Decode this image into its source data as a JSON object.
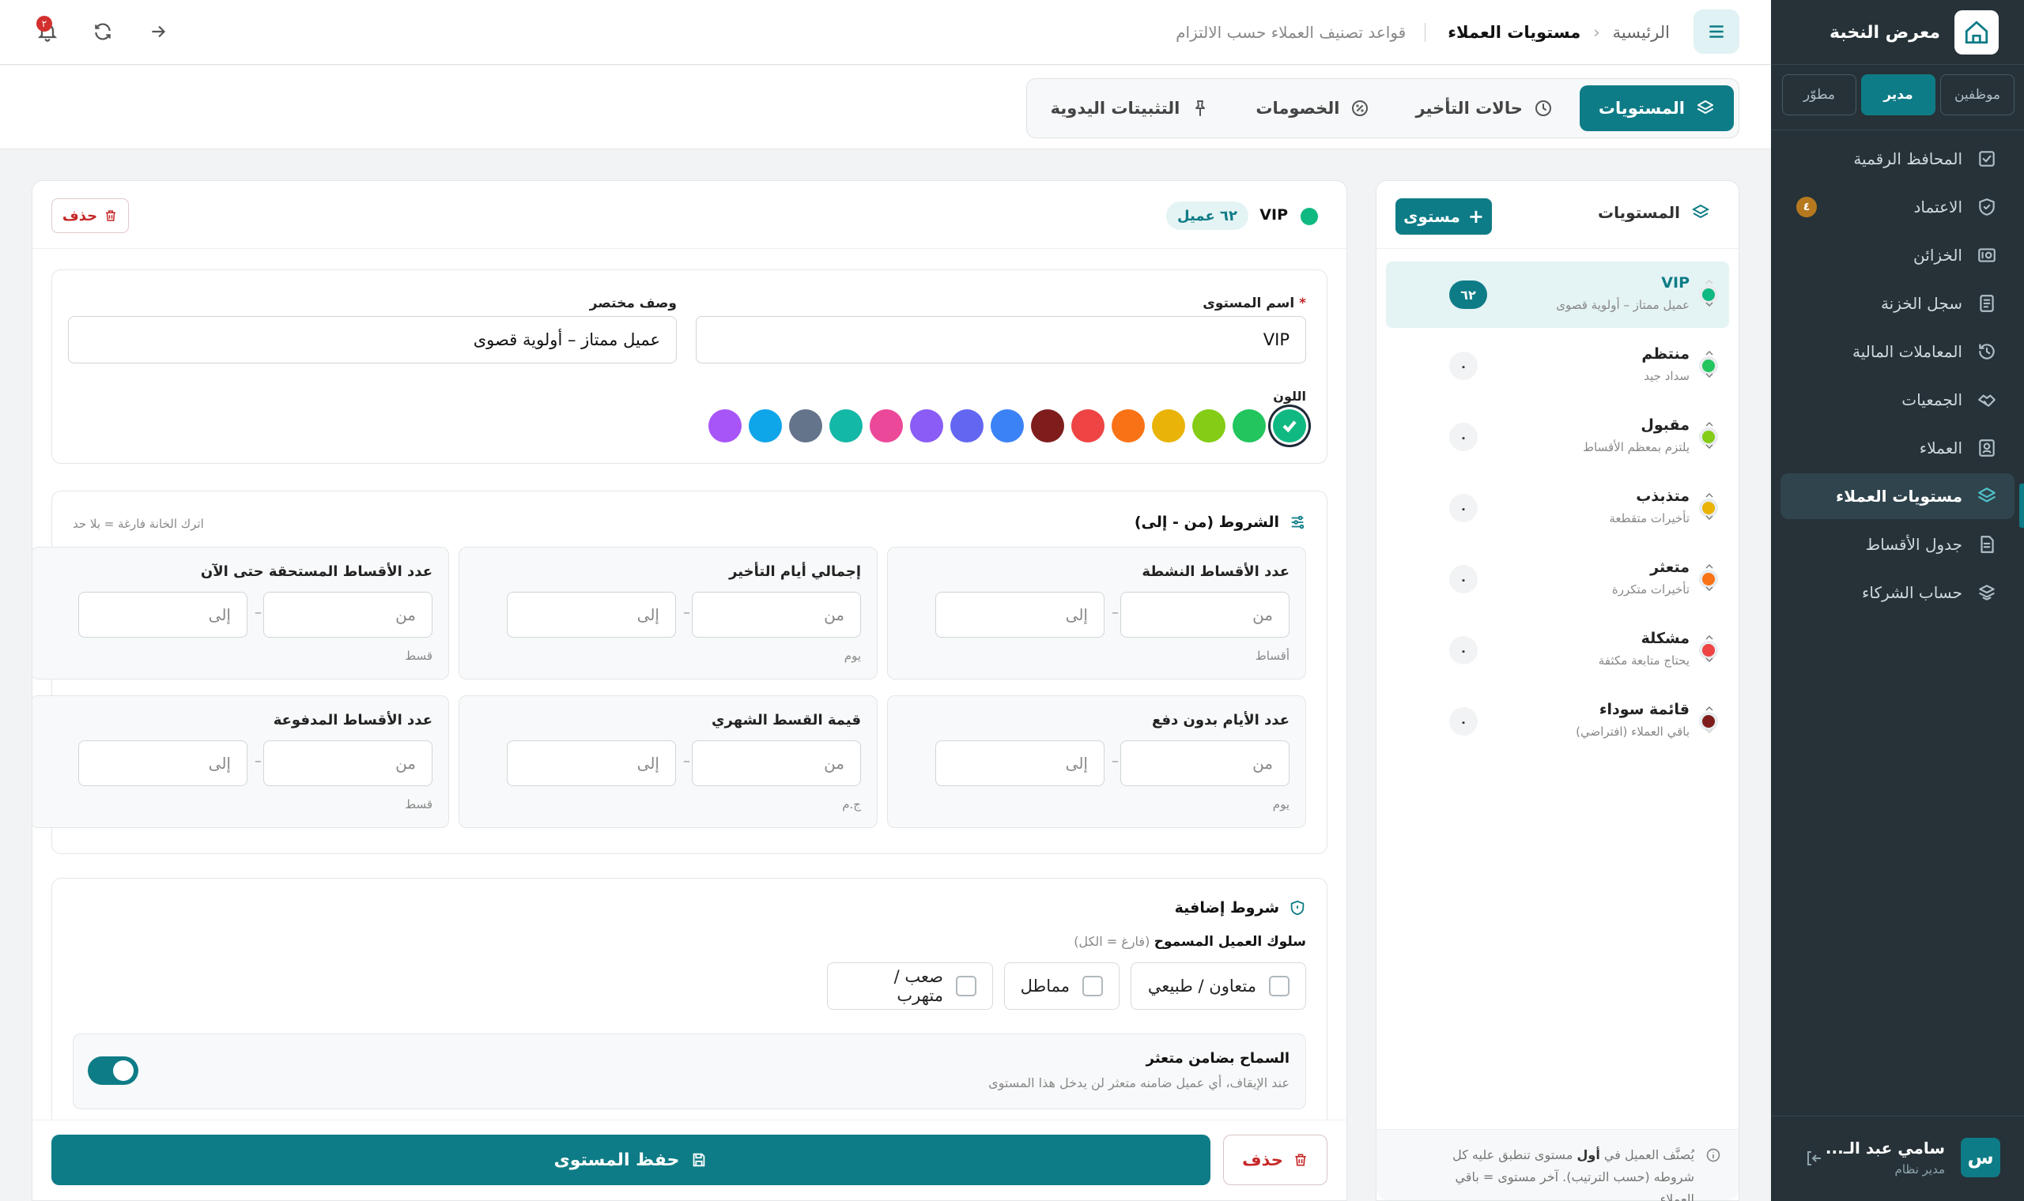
{
  "app": {
    "name": "معرض النخبة"
  },
  "roles": [
    "موظفين",
    "مدير",
    "مطوّر"
  ],
  "active_role": "مدير",
  "nav": [
    {
      "label": "المحافظ الرقمية",
      "icon": "wallet-check-icon"
    },
    {
      "label": "الاعتماد",
      "icon": "shield-check-icon",
      "badge": "٤"
    },
    {
      "label": "الخزائن",
      "icon": "safe-icon"
    },
    {
      "label": "سجل الخزنة",
      "icon": "ledger-icon"
    },
    {
      "label": "المعاملات المالية",
      "icon": "history-icon"
    },
    {
      "label": "الجمعيات",
      "icon": "handshake-icon"
    },
    {
      "label": "العملاء",
      "icon": "contacts-icon"
    },
    {
      "label": "مستويات العملاء",
      "icon": "layers-icon",
      "active": true
    },
    {
      "label": "جدول الأقساط",
      "icon": "document-icon"
    },
    {
      "label": "حساب الشركاء",
      "icon": "partners-icon"
    }
  ],
  "user": {
    "initial": "س",
    "name": "سامي عبد الـ...",
    "role": "مدير نظام"
  },
  "breadcrumb": {
    "home": "الرئيسية",
    "current": "مستويات العملاء",
    "description": "قواعد تصنيف العملاء حسب الالتزام"
  },
  "notifications": {
    "count": "٢"
  },
  "tabs": [
    {
      "label": "المستويات",
      "icon": "layers-icon",
      "active": true
    },
    {
      "label": "حالات التأخير",
      "icon": "clock-icon"
    },
    {
      "label": "الخصومات",
      "icon": "percent-icon"
    },
    {
      "label": "التثبيتات اليدوية",
      "icon": "pin-icon"
    }
  ],
  "levels_panel": {
    "title": "المستويات",
    "add_label": "مستوى",
    "items": [
      {
        "name": "VIP",
        "desc": "عميل ممتاز – أولوية قصوى",
        "count": "٦٢",
        "color": "#10b981",
        "selected": true
      },
      {
        "name": "منتظم",
        "desc": "سداد جيد",
        "count": "٠",
        "color": "#22c55e"
      },
      {
        "name": "مقبول",
        "desc": "يلتزم بمعظم الأقساط",
        "count": "٠",
        "color": "#84cc16"
      },
      {
        "name": "متذبذب",
        "desc": "تأخيرات متقطعة",
        "count": "٠",
        "color": "#eab308"
      },
      {
        "name": "متعثر",
        "desc": "تأخيرات متكررة",
        "count": "٠",
        "color": "#f97316"
      },
      {
        "name": "مشكلة",
        "desc": "يحتاج متابعة مكثفة",
        "count": "٠",
        "color": "#ef4444"
      },
      {
        "name": "قائمة سوداء",
        "desc": "باقي العملاء (افتراضي)",
        "count": "٠",
        "color": "#7f1d1d"
      }
    ],
    "footer_pre": "يُصنَّف العميل في",
    "footer_bold": "أول",
    "footer_post": "مستوى تنطبق عليه كل شروطه (حسب الترتيب). آخر مستوى = باقي العملاء."
  },
  "editor": {
    "level_name": "VIP",
    "level_color": "#10b981",
    "clients_badge": "٦٢ عميل",
    "delete_label": "حذف",
    "name_label": "اسم المستوى",
    "name_required": "*",
    "name_value": "VIP",
    "desc_label": "وصف مختصر",
    "desc_value": "عميل ممتاز – أولوية قصوى",
    "color_label": "اللون",
    "colors": [
      "#10b981",
      "#22c55e",
      "#84cc16",
      "#eab308",
      "#f97316",
      "#ef4444",
      "#7f1d1d",
      "#3b82f6",
      "#6366f1",
      "#8b5cf6",
      "#ec4899",
      "#14b8a6",
      "#64748b",
      "#0ea5e9",
      "#a855f7"
    ],
    "selected_color": "#10b981",
    "conditions_title": "الشروط (من - إلى)",
    "conditions_hint": "اترك الخانة فارغة = بلا حد",
    "from_placeholder": "من",
    "to_placeholder": "إلى",
    "conditions": [
      {
        "label": "عدد الأقساط النشطة",
        "unit": "أقساط"
      },
      {
        "label": "إجمالي أيام التأخير",
        "unit": "يوم"
      },
      {
        "label": "عدد الأقساط المستحقة حتى الآن",
        "unit": "قسط"
      },
      {
        "label": "عدد الأيام بدون دفع",
        "unit": "يوم"
      },
      {
        "label": "قيمة القسط الشهري",
        "unit": "ج.م"
      },
      {
        "label": "عدد الأقساط المدفوعة",
        "unit": "قسط"
      }
    ],
    "extra_title": "شروط إضافية",
    "behavior_label": "سلوك العميل المسموح",
    "behavior_hint": "(فارغ = الكل)",
    "behaviors": [
      "متعاون / طبيعي",
      "مماطل",
      "صعب / متهرب"
    ],
    "guarantor_title": "السماح بضامن متعثر",
    "guarantor_desc": "عند الإيقاف، أي عميل ضامنه متعثر لن يدخل هذا المستوى",
    "guarantor_enabled": true,
    "save_label": "حفظ المستوى",
    "delete_bottom_label": "حذف"
  }
}
